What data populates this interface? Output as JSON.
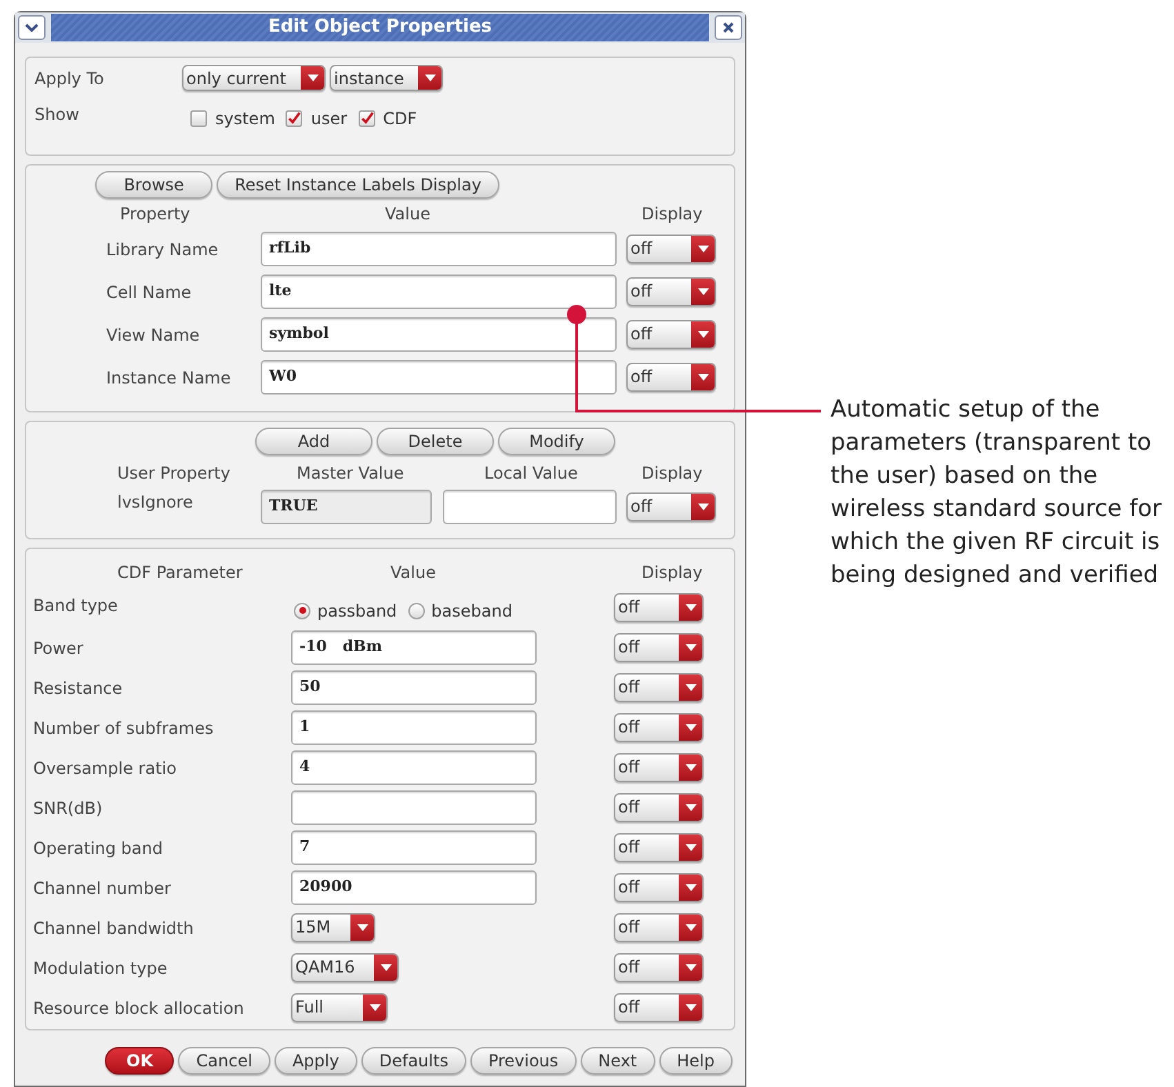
{
  "window": {
    "title": "Edit Object Properties"
  },
  "apply_to": {
    "label": "Apply To",
    "selects": [
      "only current",
      "instance"
    ]
  },
  "show": {
    "label": "Show",
    "options": [
      {
        "label": "system",
        "checked": false
      },
      {
        "label": "user",
        "checked": true
      },
      {
        "label": "CDF",
        "checked": true
      }
    ]
  },
  "instance_section": {
    "buttons": [
      "Browse",
      "Reset Instance Labels Display"
    ],
    "headers": [
      "Property",
      "Value",
      "Display"
    ],
    "rows": [
      {
        "label": "Library Name",
        "value": "rfLib",
        "display": "off"
      },
      {
        "label": "Cell Name",
        "value": "lte",
        "display": "off"
      },
      {
        "label": "View Name",
        "value": "symbol",
        "display": "off"
      },
      {
        "label": "Instance Name",
        "value": "W0",
        "display": "off"
      }
    ]
  },
  "user_section": {
    "buttons": [
      "Add",
      "Delete",
      "Modify"
    ],
    "headers": [
      "User Property",
      "Master Value",
      "Local Value",
      "Display"
    ],
    "rows": [
      {
        "label": "lvsIgnore",
        "master_value": "TRUE",
        "display": "off"
      }
    ]
  },
  "cdf_section": {
    "headers": [
      "CDF Parameter",
      "Value",
      "Display"
    ],
    "rows": [
      {
        "kind": "radio",
        "label": "Band type",
        "options": [
          {
            "label": "passband",
            "selected": true
          },
          {
            "label": "baseband",
            "selected": false
          }
        ],
        "display": "off"
      },
      {
        "kind": "text",
        "label": "Power",
        "value": "-10   dBm",
        "display": "off"
      },
      {
        "kind": "text",
        "label": "Resistance",
        "value": "50",
        "display": "off"
      },
      {
        "kind": "text",
        "label": "Number of subframes",
        "value": "1",
        "display": "off"
      },
      {
        "kind": "text",
        "label": "Oversample ratio",
        "value": "4",
        "display": "off"
      },
      {
        "kind": "text",
        "label": "SNR(dB)",
        "display": "off"
      },
      {
        "kind": "text",
        "label": "Operating band",
        "value": "7",
        "display": "off"
      },
      {
        "kind": "text",
        "label": "Channel number",
        "value": "20900",
        "display": "off"
      },
      {
        "kind": "select",
        "label": "Channel bandwidth",
        "value": "15M",
        "display": "off"
      },
      {
        "kind": "select",
        "label": "Modulation type",
        "value": "QAM16",
        "display": "off"
      },
      {
        "kind": "select",
        "label": "Resource block allocation",
        "value": "Full",
        "display": "off"
      }
    ]
  },
  "footer_buttons": [
    {
      "label": "OK",
      "kind": "primary"
    },
    {
      "label": "Cancel",
      "kind": "normal"
    },
    {
      "label": "Apply",
      "kind": "normal"
    },
    {
      "label": "Defaults",
      "kind": "normal"
    },
    {
      "label": "Previous",
      "kind": "normal"
    },
    {
      "label": "Next",
      "kind": "normal"
    },
    {
      "label": "Help",
      "kind": "normal"
    }
  ],
  "annotation": "Automatic setup of the parameters (transparent to the user) based on the wireless standard source for which the given RF circuit is being designed and verified"
}
